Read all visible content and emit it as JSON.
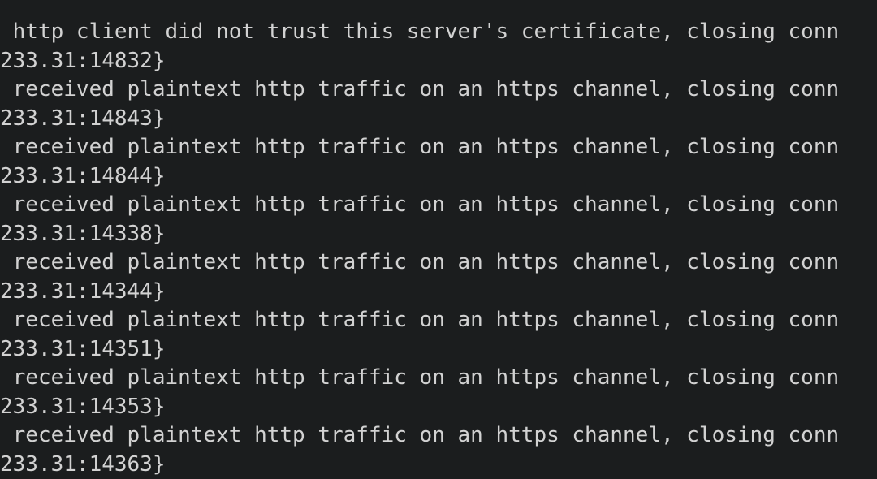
{
  "terminal": {
    "background_color": "#1b1d1e",
    "text_color": "#d2d2d2",
    "font_size_px": 26,
    "line_height_px": 35.5,
    "log_entries": [
      {
        "message_line": " http client did not trust this server's certificate, closing conn",
        "wrap_line": "233.31:14832}"
      },
      {
        "message_line": " received plaintext http traffic on an https channel, closing conn",
        "wrap_line": "233.31:14843}"
      },
      {
        "message_line": " received plaintext http traffic on an https channel, closing conn",
        "wrap_line": "233.31:14844}"
      },
      {
        "message_line": " received plaintext http traffic on an https channel, closing conn",
        "wrap_line": "233.31:14338}"
      },
      {
        "message_line": " received plaintext http traffic on an https channel, closing conn",
        "wrap_line": "233.31:14344}"
      },
      {
        "message_line": " received plaintext http traffic on an https channel, closing conn",
        "wrap_line": "233.31:14351}"
      },
      {
        "message_line": " received plaintext http traffic on an https channel, closing conn",
        "wrap_line": "233.31:14353}"
      },
      {
        "message_line": " received plaintext http traffic on an https channel, closing conn",
        "wrap_line": "233.31:14363}"
      }
    ]
  }
}
